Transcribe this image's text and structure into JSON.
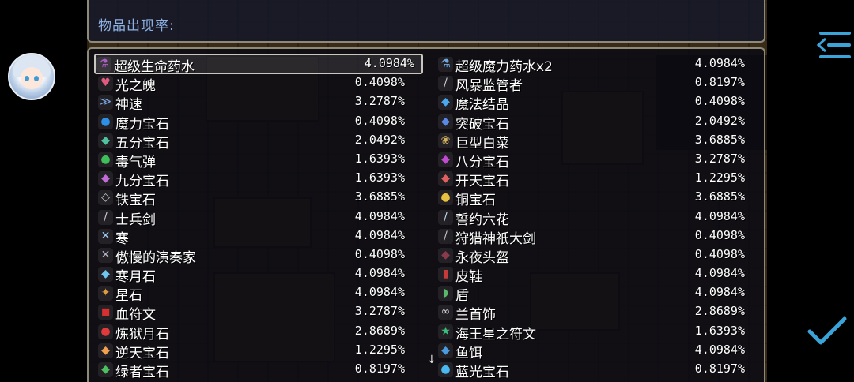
{
  "header": {
    "title": "物品出现率:"
  },
  "items_left": [
    {
      "name": "超级生命药水",
      "rate": "4.0984%",
      "icon": "potion-icon",
      "color": "#b05cc8",
      "glyph": "⚗"
    },
    {
      "name": "光之魄",
      "rate": "0.4098%",
      "icon": "heart-gem-icon",
      "color": "#e05a80",
      "glyph": "♥"
    },
    {
      "name": "神速",
      "rate": "3.2787%",
      "icon": "boots-icon",
      "color": "#7aa6e0",
      "glyph": "≫"
    },
    {
      "name": "魔力宝石",
      "rate": "0.4098%",
      "icon": "blue-drop-icon",
      "color": "#2c8fe8",
      "glyph": "●"
    },
    {
      "name": "五分宝石",
      "rate": "2.0492%",
      "icon": "gems-icon",
      "color": "#4fc3a0",
      "glyph": "◆"
    },
    {
      "name": "毒气弹",
      "rate": "1.6393%",
      "icon": "green-orb-icon",
      "color": "#3fbf5a",
      "glyph": "●"
    },
    {
      "name": "九分宝石",
      "rate": "1.6393%",
      "icon": "gem-cluster-icon",
      "color": "#c26ad8",
      "glyph": "◆"
    },
    {
      "name": "铁宝石",
      "rate": "3.6885%",
      "icon": "silver-gem-icon",
      "color": "#c8c8d4",
      "glyph": "◇"
    },
    {
      "name": "士兵剑",
      "rate": "4.0984%",
      "icon": "sword-icon",
      "color": "#c8c8d8",
      "glyph": "/"
    },
    {
      "name": "寒",
      "rate": "4.0984%",
      "icon": "crossed-swords-icon",
      "color": "#9ec8f0",
      "glyph": "✕"
    },
    {
      "name": "傲慢的演奏家",
      "rate": "0.4098%",
      "icon": "crossed-blades-icon",
      "color": "#b0b0c8",
      "glyph": "✕"
    },
    {
      "name": "寒月石",
      "rate": "4.0984%",
      "icon": "ice-stone-icon",
      "color": "#6ec6f0",
      "glyph": "◆"
    },
    {
      "name": "星石",
      "rate": "4.0984%",
      "icon": "star-stone-icon",
      "color": "#e09a40",
      "glyph": "✦"
    },
    {
      "name": "血符文",
      "rate": "3.2787%",
      "icon": "blood-rune-icon",
      "color": "#d83030",
      "glyph": "◼"
    },
    {
      "name": "炼狱月石",
      "rate": "2.8689%",
      "icon": "red-orb-icon",
      "color": "#e03a3a",
      "glyph": "●"
    },
    {
      "name": "逆天宝石",
      "rate": "1.2295%",
      "icon": "orange-gem-icon",
      "color": "#f0a050",
      "glyph": "◆"
    },
    {
      "name": "绿者宝石",
      "rate": "0.8197%",
      "icon": "green-gem-icon",
      "color": "#4cc060",
      "glyph": "◆"
    }
  ],
  "items_right": [
    {
      "name": "超级魔力药水x2",
      "rate": "4.0984%",
      "icon": "mana-potion-icon",
      "color": "#6ea8e0",
      "glyph": "⚗"
    },
    {
      "name": "风暴监管者",
      "rate": "0.8197%",
      "icon": "dagger-icon",
      "color": "#c8c8d0",
      "glyph": "/"
    },
    {
      "name": "魔法结晶",
      "rate": "0.4098%",
      "icon": "crystal-icon",
      "color": "#4aa8f0",
      "glyph": "◆"
    },
    {
      "name": "突破宝石",
      "rate": "2.0492%",
      "icon": "blue-gems-icon",
      "color": "#5a8ae8",
      "glyph": "◆"
    },
    {
      "name": "巨型白菜",
      "rate": "3.6885%",
      "icon": "cabbage-icon",
      "color": "#d4b060",
      "glyph": "❀"
    },
    {
      "name": "八分宝石",
      "rate": "3.2787%",
      "icon": "purple-gems-icon",
      "color": "#c04ad0",
      "glyph": "◆"
    },
    {
      "name": "开天宝石",
      "rate": "1.2295%",
      "icon": "rainbow-gem-icon",
      "color": "#e06060",
      "glyph": "◆"
    },
    {
      "name": "铜宝石",
      "rate": "3.6885%",
      "icon": "gold-gem-icon",
      "color": "#e8c040",
      "glyph": "●"
    },
    {
      "name": "誓约六花",
      "rate": "4.0984%",
      "icon": "ice-sword-icon",
      "color": "#b8d8f0",
      "glyph": "/"
    },
    {
      "name": "狩猎神祇大剑",
      "rate": "0.4098%",
      "icon": "greatsword-icon",
      "color": "#c0c0c8",
      "glyph": "/"
    },
    {
      "name": "永夜头盔",
      "rate": "0.4098%",
      "icon": "dark-helmet-icon",
      "color": "#8a3a4a",
      "glyph": "◆"
    },
    {
      "name": "皮鞋",
      "rate": "4.0984%",
      "icon": "red-boots-icon",
      "color": "#c83a3a",
      "glyph": "▮"
    },
    {
      "name": "盾",
      "rate": "4.0984%",
      "icon": "shield-icon",
      "color": "#5ab86a",
      "glyph": "◗"
    },
    {
      "name": "兰首饰",
      "rate": "2.8689%",
      "icon": "necklace-icon",
      "color": "#d0d0d8",
      "glyph": "∞"
    },
    {
      "name": "海王星之符文",
      "rate": "1.6393%",
      "icon": "star-rune-icon",
      "color": "#3ac07a",
      "glyph": "★"
    },
    {
      "name": "鱼饵",
      "rate": "4.0984%",
      "icon": "bait-icon",
      "color": "#4a9ae0",
      "glyph": "◆"
    },
    {
      "name": "蓝光宝石",
      "rate": "0.8197%",
      "icon": "blue-light-gem-icon",
      "color": "#4ab8f0",
      "glyph": "●"
    }
  ],
  "scroll_indicator": "↓",
  "colors": {
    "accent": "#3aa3d8",
    "title": "#8eb2e6",
    "border": "#8e8a78"
  }
}
